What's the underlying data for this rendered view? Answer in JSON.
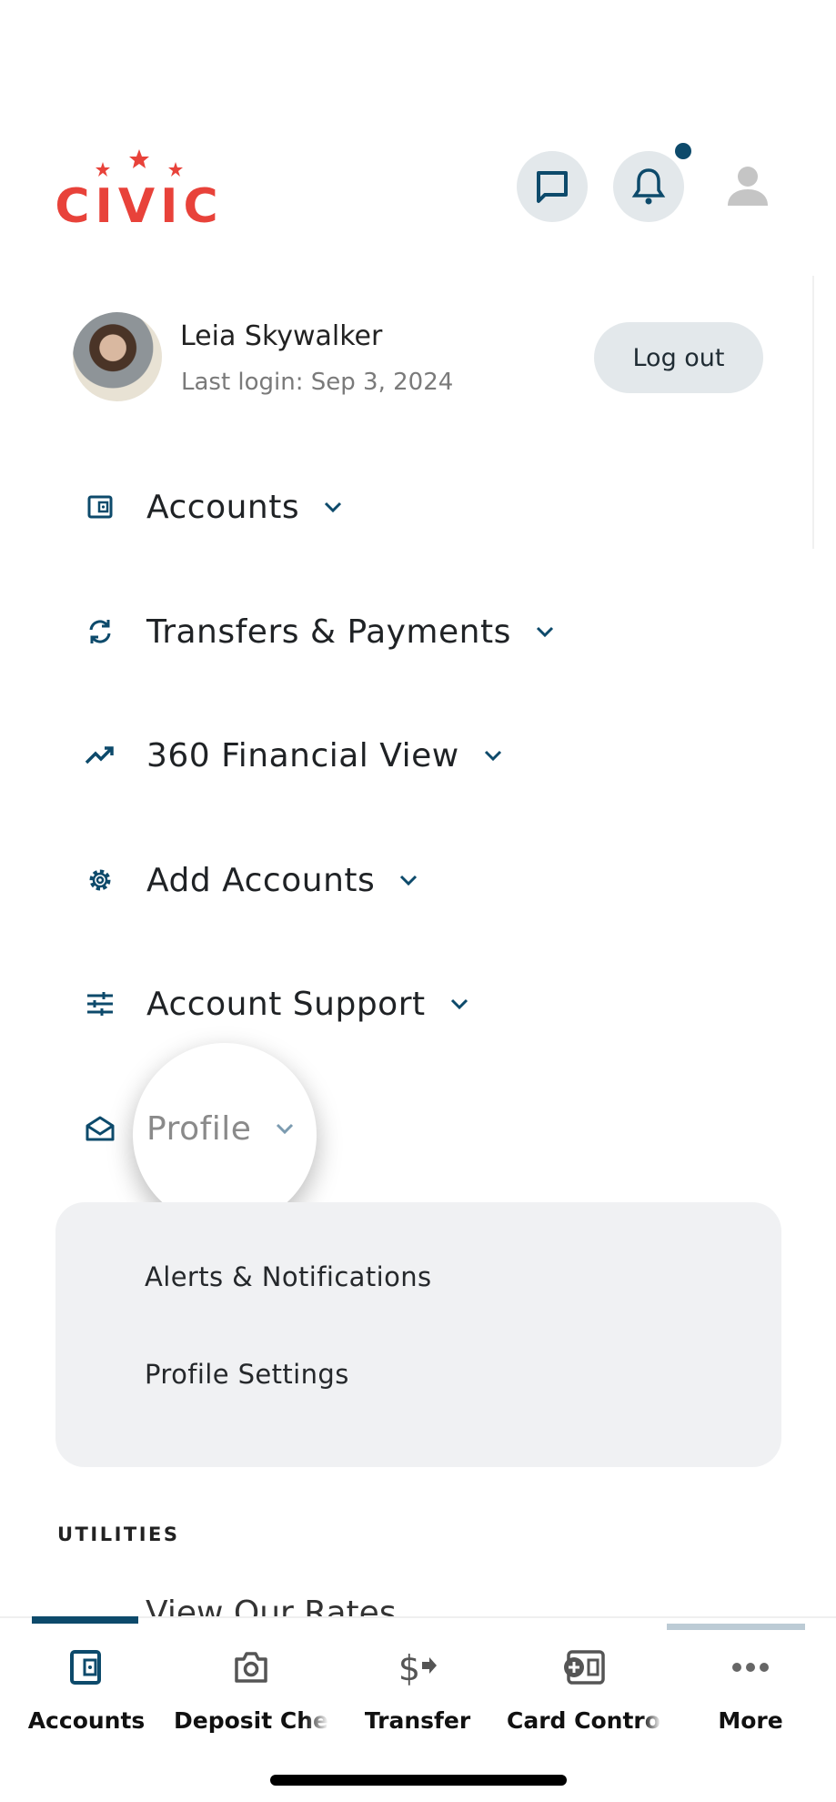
{
  "header": {
    "logo_text": "CIVIC",
    "brand_color": "#e8423a",
    "icons": [
      "chat-icon",
      "bell-icon",
      "person-icon"
    ],
    "notification_dot": true
  },
  "user": {
    "name": "Leia Skywalker",
    "last_login": "Last login: Sep 3, 2024",
    "logout_label": "Log out"
  },
  "menu": {
    "items": [
      {
        "label": "Accounts",
        "icon": "wallet-icon"
      },
      {
        "label": "Transfers & Payments",
        "icon": "sync-icon"
      },
      {
        "label": "360 Financial View",
        "icon": "trending-up-icon"
      },
      {
        "label": "Add Accounts",
        "icon": "gear-icon"
      },
      {
        "label": "Account Support",
        "icon": "sliders-icon"
      },
      {
        "label": "Profile",
        "icon": "envelope-open-icon"
      }
    ],
    "profile_submenu": [
      "Alerts & Notifications",
      "Profile Settings"
    ]
  },
  "utilities": {
    "heading": "UTILITIES",
    "items": [
      "View Our Rates"
    ]
  },
  "bottom_nav": {
    "items": [
      {
        "label": "Accounts",
        "icon": "wallet-icon",
        "active": true
      },
      {
        "label": "Deposit Chec",
        "icon": "camera-icon"
      },
      {
        "label": "Transfer",
        "icon": "dollar-transfer-icon"
      },
      {
        "label": "Card Control",
        "icon": "card-plus-icon"
      },
      {
        "label": "More",
        "icon": "more-dots-icon"
      }
    ]
  },
  "colors": {
    "accent": "#0d4a6b",
    "brand": "#e8423a",
    "panel": "#f0f1f3"
  }
}
